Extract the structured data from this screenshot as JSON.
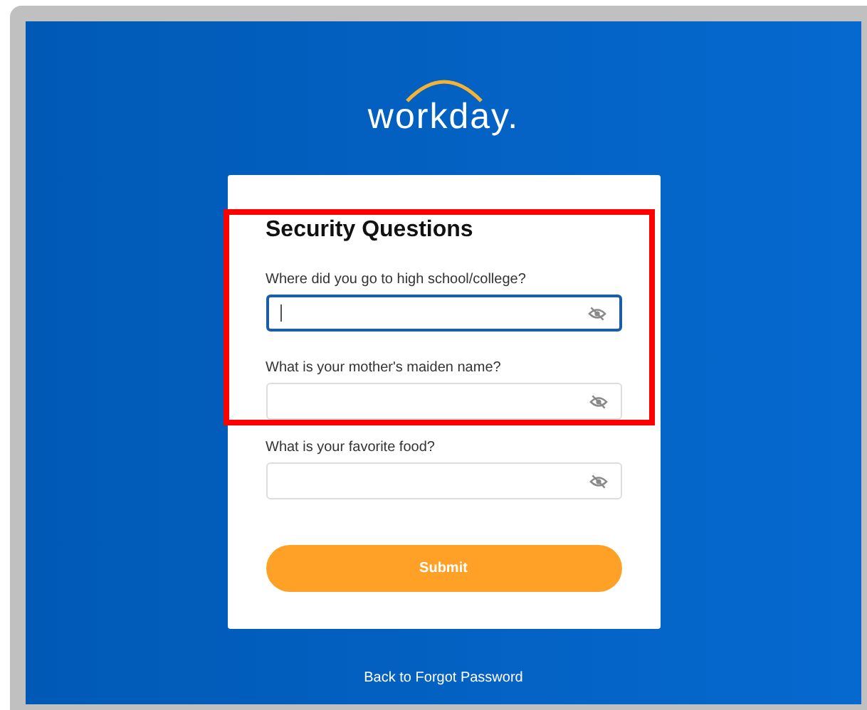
{
  "logo": {
    "text": "workday."
  },
  "card": {
    "title": "Security Questions",
    "questions": [
      {
        "label": "Where did you go to high school/college?",
        "focused": true,
        "highlighted": true
      },
      {
        "label": "What is your mother's maiden name?",
        "focused": false,
        "highlighted": true
      },
      {
        "label": "What is your favorite food?",
        "focused": false,
        "highlighted": false
      }
    ],
    "submit": "Submit"
  },
  "footer_link": "Back to Forgot Password"
}
